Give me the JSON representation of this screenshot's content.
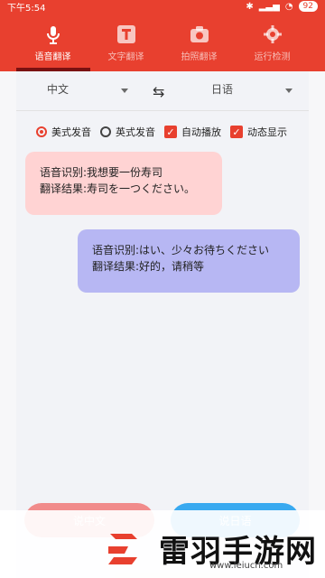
{
  "status": {
    "time": "下午5:54",
    "battery": "92"
  },
  "tabs": [
    {
      "label": "语音翻译",
      "icon": "microphone-icon"
    },
    {
      "label": "文字翻译",
      "icon": "text-t-icon"
    },
    {
      "label": "拍照翻译",
      "icon": "camera-icon"
    },
    {
      "label": "运行检测",
      "icon": "gear-icon"
    }
  ],
  "languages": {
    "source": "中文",
    "target": "日语",
    "swap": "⇆"
  },
  "options": [
    {
      "label": "美式发音",
      "type": "radio",
      "checked": true
    },
    {
      "label": "英式发音",
      "type": "radio",
      "checked": false
    },
    {
      "label": "自动播放",
      "type": "checkbox",
      "checked": true
    },
    {
      "label": "动态显示",
      "type": "checkbox",
      "checked": true
    }
  ],
  "messages": {
    "left": {
      "recognized": "语音识别:我想要一份寿司",
      "translated": "翻译结果:寿司を一つください。"
    },
    "right": {
      "recognized": "语音识别:はい、少々お待ちください",
      "translated": "翻译结果:好的，请稍等"
    }
  },
  "bottom_buttons": {
    "left": "说中文",
    "right": "说日语"
  },
  "watermark": {
    "title": "雷羽手游网",
    "url": "www.leiucn.com"
  },
  "colors": {
    "primary": "#e8402f",
    "left_bubble": "#ffd3d3",
    "right_bubble": "#b7b7f3",
    "left_button": "#f18b8b",
    "right_button": "#39a9f0"
  }
}
